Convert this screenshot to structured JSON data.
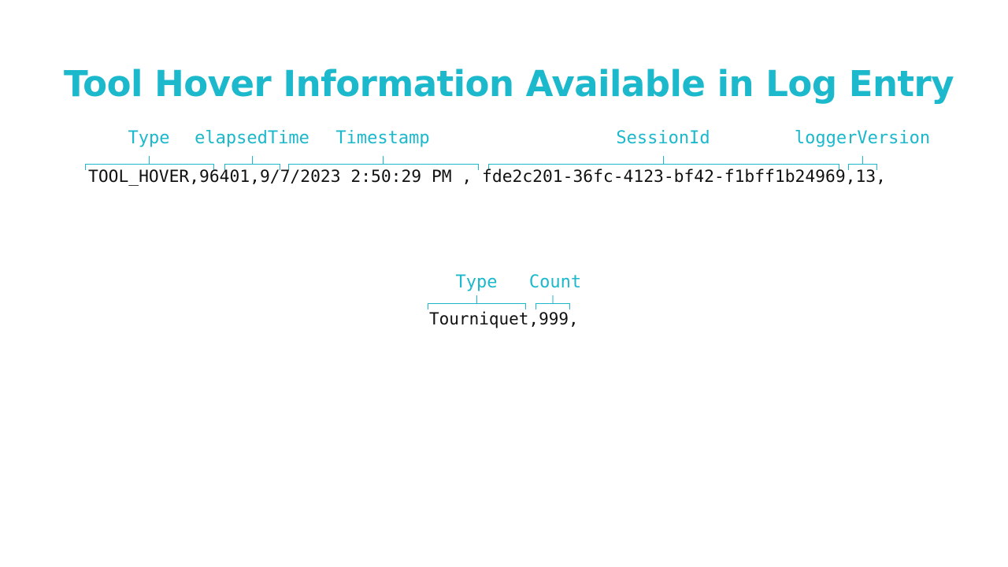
{
  "title": "Tool Hover Information Available in Log Entry",
  "colors": {
    "accent": "#1CB8CB",
    "text": "#111111",
    "background": "#FFFFFF"
  },
  "log_entry": {
    "text": "TOOL_HOVER,96401,9/7/2023 2:50:29 PM , fde2c201-36fc-4123-bf42-f1bff1b24969,13,",
    "fields": [
      {
        "label": "Type",
        "value": "TOOL_HOVER"
      },
      {
        "label": "elapsedTime",
        "value": "96401"
      },
      {
        "label": "Timestamp",
        "value": "9/7/2023 2:50:29 PM"
      },
      {
        "label": "SessionId",
        "value": "fde2c201-36fc-4123-bf42-f1bff1b24969"
      },
      {
        "label": "loggerVersion",
        "value": "13"
      }
    ]
  },
  "hover_info": {
    "text": "Tourniquet,999,",
    "fields": [
      {
        "label": "Type",
        "value": "Tourniquet"
      },
      {
        "label": "Count",
        "value": "999"
      }
    ]
  }
}
